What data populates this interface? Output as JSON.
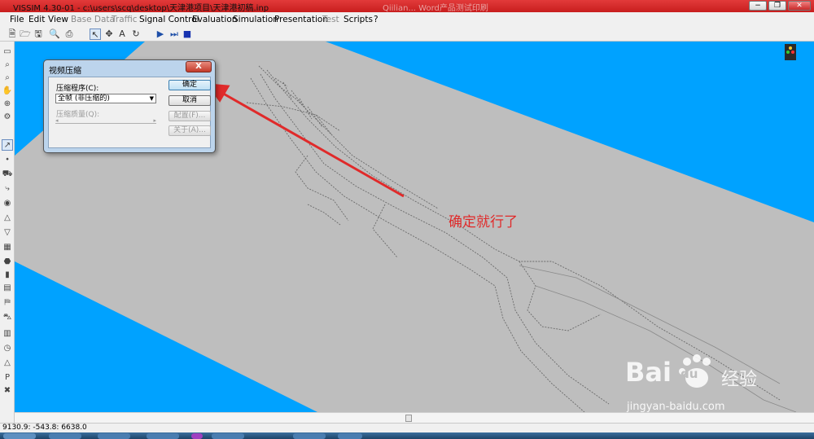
{
  "window": {
    "title": "VISSIM 4.30-01 - c:\\users\\scq\\desktop\\天津港项目\\天津港初稿.inp",
    "background_title": "Qiilian... Word产品测试印刷",
    "minimize": "−",
    "restore": "❐",
    "close": "✕"
  },
  "menu": [
    "File",
    "Edit",
    "View",
    "Base Data",
    "Traffic",
    "Signal Control",
    "Evaluation",
    "Simulation",
    "Presentation",
    "Test",
    "Scripts",
    "?"
  ],
  "menu_disabled": [
    "Base Data",
    "Traffic",
    "Test"
  ],
  "toolbar": {
    "icons": [
      "new-icon",
      "open-icon",
      "save-icon",
      "print-preview-icon",
      "print-icon",
      "select-icon",
      "pan-icon",
      "text-icon",
      "rotate-icon",
      "play-icon",
      "step-icon",
      "stop-icon"
    ]
  },
  "dialog": {
    "title": "视频压缩",
    "close": "X",
    "compressor_label": "压缩程序(C):",
    "compressor_value": "全帧 (非压缩的)",
    "quality_label": "压缩质量(Q):",
    "ok": "确定",
    "cancel": "取消",
    "configure": "配置(F)...",
    "about": "关于(A)..."
  },
  "annotation": "确定就行了",
  "watermark": {
    "brand": "Bai",
    "paw": "du",
    "cn": "经验",
    "url": "jingyan-baidu.com"
  },
  "status": {
    "coords": "9130.9: -543.8: 6638.0"
  },
  "colors": {
    "title_bar": "#d32b2b",
    "canvas_bg": "#00a2ff",
    "road_area": "#bebebe",
    "annotation": "#e02a2a",
    "arrow": "#e02a2a"
  }
}
